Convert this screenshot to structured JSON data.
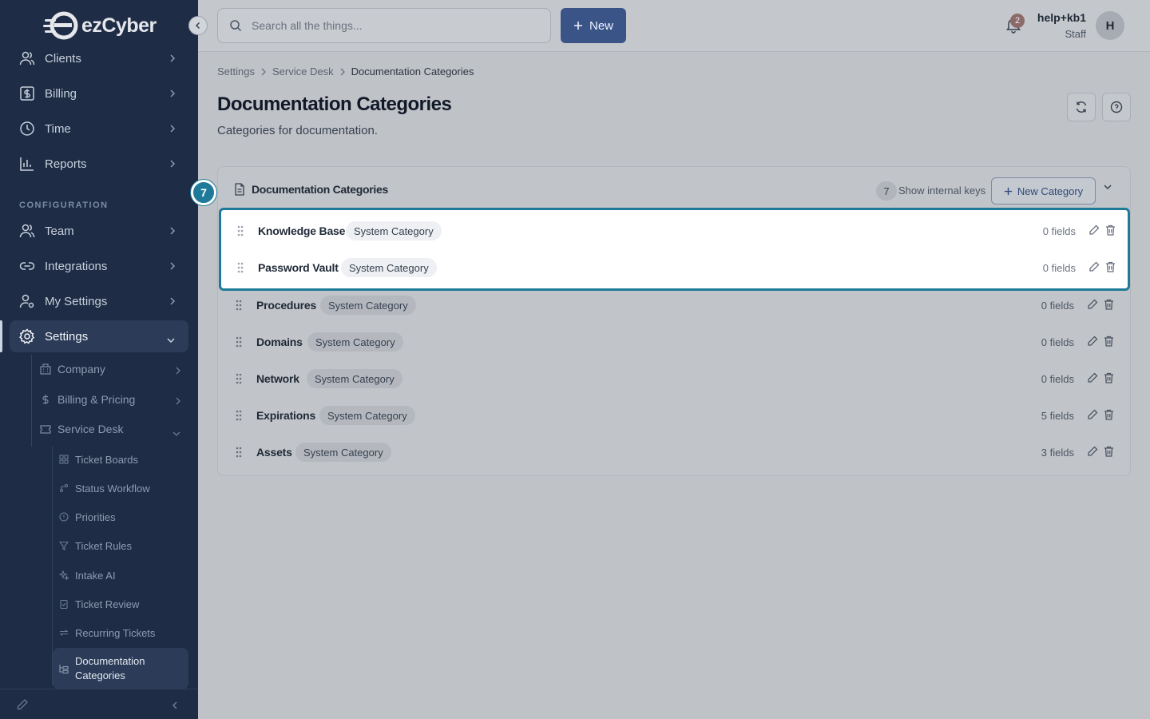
{
  "brand": {
    "name": "ezCyber"
  },
  "sidebar": {
    "items": [
      {
        "label": "Clients",
        "icon": "users-icon"
      },
      {
        "label": "Billing",
        "icon": "dollar-icon"
      },
      {
        "label": "Time",
        "icon": "clock-icon"
      },
      {
        "label": "Reports",
        "icon": "bar-chart-icon"
      }
    ],
    "section_label": "CONFIGURATION",
    "config_items": [
      {
        "label": "Team",
        "icon": "users-icon"
      },
      {
        "label": "Integrations",
        "icon": "link-icon"
      },
      {
        "label": "My Settings",
        "icon": "user-gear-icon"
      },
      {
        "label": "Settings",
        "icon": "gear-icon"
      }
    ],
    "settings_children": [
      {
        "label": "Company",
        "icon": "building-icon"
      },
      {
        "label": "Billing & Pricing",
        "icon": "dollar-icon"
      },
      {
        "label": "Service Desk",
        "icon": "ticket-icon"
      }
    ],
    "service_desk_children": [
      {
        "label": "Ticket Boards",
        "icon": "grid-icon"
      },
      {
        "label": "Status Workflow",
        "icon": "workflow-icon"
      },
      {
        "label": "Priorities",
        "icon": "alert-circle-icon"
      },
      {
        "label": "Ticket Rules",
        "icon": "filter-icon"
      },
      {
        "label": "Intake AI",
        "icon": "sparkle-icon"
      },
      {
        "label": "Ticket Review",
        "icon": "clipboard-check-icon"
      },
      {
        "label": "Recurring Tickets",
        "icon": "repeat-icon"
      },
      {
        "label": "Documentation Categories",
        "icon": "folder-tree-icon"
      }
    ]
  },
  "topbar": {
    "search_placeholder": "Search all the things...",
    "new_label": "New",
    "notification_count": "2",
    "user_name": "help+kb1",
    "user_role": "Staff",
    "avatar_initial": "H"
  },
  "breadcrumb": [
    "Settings",
    "Service Desk",
    "Documentation Categories"
  ],
  "page": {
    "title": "Documentation Categories",
    "subtitle": "Categories for documentation."
  },
  "card": {
    "title": "Documentation Categories",
    "count": "7",
    "internal_keys_label": "Show internal keys",
    "new_button_label": "New Category",
    "step_badge": "7",
    "rows": [
      {
        "name": "Knowledge Base",
        "tag": "System Category",
        "fields": "0 fields"
      },
      {
        "name": "Password Vault",
        "tag": "System Category",
        "fields": "0 fields"
      },
      {
        "name": "Procedures",
        "tag": "System Category",
        "fields": "0 fields"
      },
      {
        "name": "Domains",
        "tag": "System Category",
        "fields": "0 fields"
      },
      {
        "name": "Network",
        "tag": "System Category",
        "fields": "0 fields"
      },
      {
        "name": "Expirations",
        "tag": "System Category",
        "fields": "5 fields"
      },
      {
        "name": "Assets",
        "tag": "System Category",
        "fields": "3 fields"
      }
    ]
  },
  "colors": {
    "sidebar_bg": "#1e2c45",
    "primary": "#3a5488",
    "highlight": "#1f7a99"
  }
}
